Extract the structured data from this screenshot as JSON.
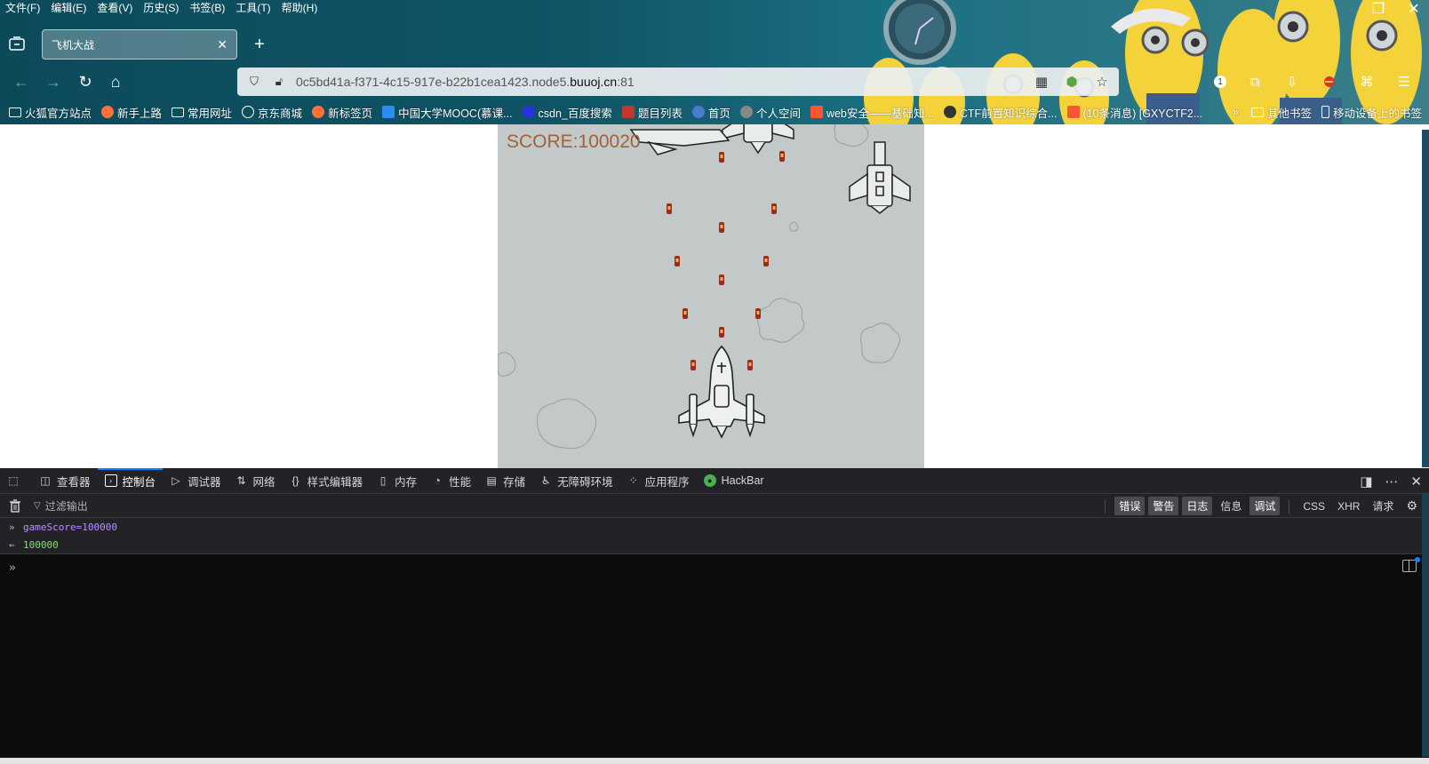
{
  "menubar": [
    "文件(F)",
    "编辑(E)",
    "查看(V)",
    "历史(S)",
    "书签(B)",
    "工具(T)",
    "帮助(H)"
  ],
  "tab": {
    "title": "飞机大战"
  },
  "url": {
    "prefix": "0c5bd41a-f371-4c15-917e-b22b1cea1423.node5.",
    "domain": "buuoj.cn",
    "suffix": ":81"
  },
  "bookmarks": [
    {
      "label": "火狐官方站点",
      "icon": "folder-icon",
      "color": "#ffffff"
    },
    {
      "label": "新手上路",
      "icon": "firefox-icon",
      "color": "#ff7139"
    },
    {
      "label": "常用网址",
      "icon": "folder-icon",
      "color": "#ffffff"
    },
    {
      "label": "京东商城",
      "icon": "globe-icon",
      "color": "#ffffff"
    },
    {
      "label": "新标签页",
      "icon": "firefox-icon",
      "color": "#ff7139"
    },
    {
      "label": "中国大学MOOC(慕课...",
      "icon": "mooc-icon",
      "color": "#2d8cf0"
    },
    {
      "label": "csdn_百度搜索",
      "icon": "baidu-icon",
      "color": "#2932e1"
    },
    {
      "label": "题目列表",
      "icon": "buu-icon",
      "color": "#c0392b"
    },
    {
      "label": "首页",
      "icon": "cloud-icon",
      "color": "#4a7bd0"
    },
    {
      "label": "个人空间",
      "icon": "globe-icon",
      "color": "#888888"
    },
    {
      "label": "web安全——基础知...",
      "icon": "csdn-icon",
      "color": "#fc5531"
    },
    {
      "label": "CTF前置知识综合...",
      "icon": "bilibili-icon",
      "color": "#333333"
    },
    {
      "label": "(10条消息) [GXYCTF2...",
      "icon": "csdn-icon",
      "color": "#fc5531"
    }
  ],
  "bookmarks_right": [
    {
      "label": "其他书签",
      "icon": "folder-icon"
    },
    {
      "label": "移动设备上的书签",
      "icon": "mobile-icon"
    }
  ],
  "game": {
    "score_text": "SCORE:100020"
  },
  "devtools": {
    "tabs": [
      {
        "label": "查看器",
        "icon": "inspector-icon"
      },
      {
        "label": "控制台",
        "icon": "console-icon",
        "active": true
      },
      {
        "label": "调试器",
        "icon": "debugger-icon"
      },
      {
        "label": "网络",
        "icon": "network-icon"
      },
      {
        "label": "样式编辑器",
        "icon": "style-editor-icon"
      },
      {
        "label": "内存",
        "icon": "memory-icon"
      },
      {
        "label": "性能",
        "icon": "performance-icon"
      },
      {
        "label": "存储",
        "icon": "storage-icon"
      },
      {
        "label": "无障碍环境",
        "icon": "accessibility-icon"
      },
      {
        "label": "应用程序",
        "icon": "application-icon"
      },
      {
        "label": "HackBar",
        "icon": "hackbar-icon"
      }
    ],
    "filter_placeholder": "过滤输出",
    "levels": [
      {
        "label": "错误",
        "on": true
      },
      {
        "label": "警告",
        "on": true
      },
      {
        "label": "日志",
        "on": true
      },
      {
        "label": "信息",
        "on": false
      },
      {
        "label": "调试",
        "on": true
      }
    ],
    "extra_filters": [
      "CSS",
      "XHR",
      "请求"
    ],
    "log": [
      {
        "type": "input",
        "text": "gameScore=100000"
      },
      {
        "type": "result",
        "text": "100000"
      }
    ]
  },
  "notification_badge": "1",
  "colors": {
    "accent": "#0a84ff",
    "score": "#a0623a",
    "game_bg": "#c3c8c8"
  }
}
